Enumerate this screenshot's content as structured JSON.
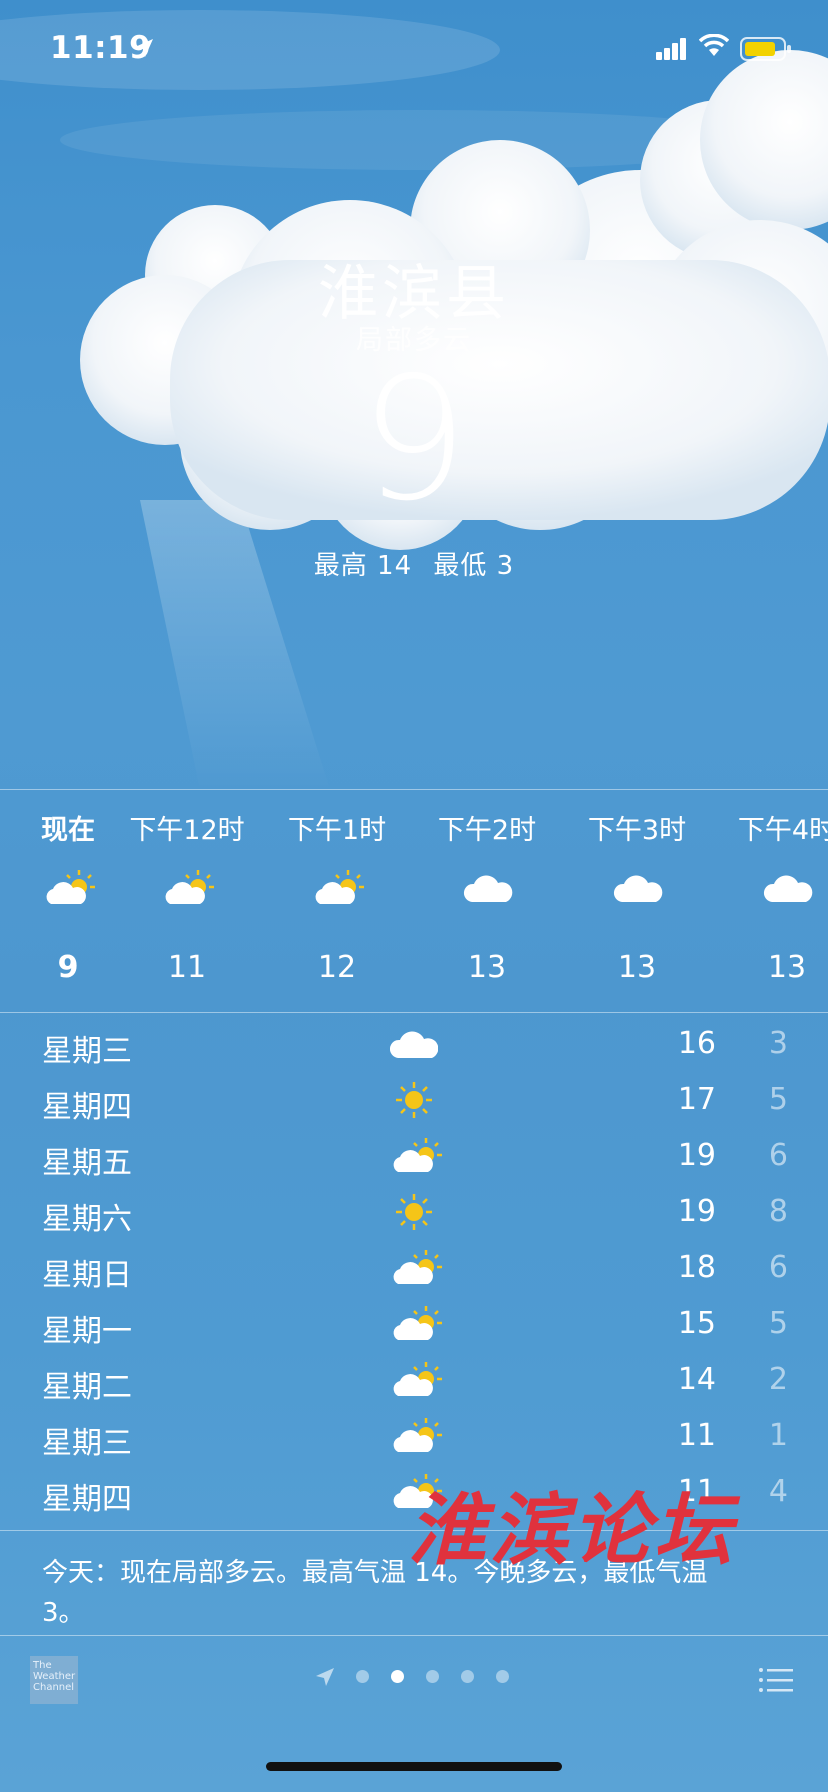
{
  "status_bar": {
    "time": "11:19"
  },
  "header": {
    "city": "淮滨县",
    "condition": "局部多云",
    "current_temp": "9",
    "high": "最高 14",
    "low": "最低 3"
  },
  "hourly": [
    {
      "label": "现在",
      "icon": "partly-cloudy-icon",
      "temp": "9"
    },
    {
      "label": "下午12时",
      "icon": "partly-cloudy-icon",
      "temp": "11"
    },
    {
      "label": "下午1时",
      "icon": "partly-cloudy-icon",
      "temp": "12"
    },
    {
      "label": "下午2时",
      "icon": "cloud-icon",
      "temp": "13"
    },
    {
      "label": "下午3时",
      "icon": "cloud-icon",
      "temp": "13"
    },
    {
      "label": "下午4时",
      "icon": "cloud-icon",
      "temp": "13"
    }
  ],
  "daily": [
    {
      "day": "星期三",
      "icon": "cloud-icon",
      "high": "16",
      "low": "3"
    },
    {
      "day": "星期四",
      "icon": "sun-icon",
      "high": "17",
      "low": "5"
    },
    {
      "day": "星期五",
      "icon": "partly-cloudy-icon",
      "high": "19",
      "low": "6"
    },
    {
      "day": "星期六",
      "icon": "sun-icon",
      "high": "19",
      "low": "8"
    },
    {
      "day": "星期日",
      "icon": "partly-cloudy-icon",
      "high": "18",
      "low": "6"
    },
    {
      "day": "星期一",
      "icon": "partly-cloudy-icon",
      "high": "15",
      "low": "5"
    },
    {
      "day": "星期二",
      "icon": "partly-cloudy-icon",
      "high": "14",
      "low": "2"
    },
    {
      "day": "星期三",
      "icon": "partly-cloudy-icon",
      "high": "11",
      "low": "1"
    },
    {
      "day": "星期四",
      "icon": "partly-cloudy-icon",
      "high": "11",
      "low": "4"
    }
  ],
  "summary": "今天：现在局部多云。最高气温 14。今晚多云，最低气温 3。",
  "watermark": "淮滨论坛",
  "footer": {
    "provider_logo": "The Weather Channel",
    "page_dots": 5,
    "active_page": 2
  },
  "colors": {
    "sun": "#f5c518",
    "battery": "#f2d200"
  }
}
